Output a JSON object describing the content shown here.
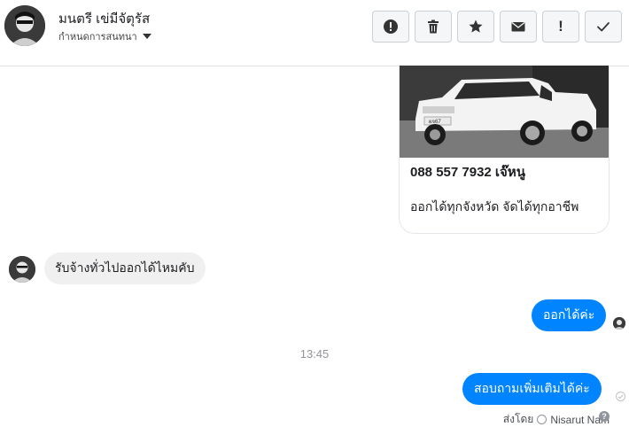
{
  "header": {
    "contact_name": "มนตรี เข่มีจัตุรัส",
    "contact_sub": "กำหนดการสนทนา",
    "toolbar": [
      {
        "name": "report-spam-button",
        "icon": "alert-circle-icon"
      },
      {
        "name": "delete-button",
        "icon": "trash-icon"
      },
      {
        "name": "star-button",
        "icon": "star-icon"
      },
      {
        "name": "mark-unread-button",
        "icon": "envelope-icon"
      },
      {
        "name": "flag-button",
        "icon": "exclamation-icon",
        "glyph": "!"
      },
      {
        "name": "mark-done-button",
        "icon": "checkmark-icon"
      }
    ]
  },
  "conversation": {
    "ad_card": {
      "line1": "088 557 7932 เจ๊หนู",
      "line2": "ออกได้ทุกจังหวัด จัดได้ทุกอาชีพ",
      "image_icon": "white-pickup-truck-photo",
      "plate": "ผจ67"
    },
    "incoming_message": "รับจ้างทั่วไปออกได้ไหมคับ",
    "outgoing_message_1": "ออกได้ค่ะ",
    "timestamp": "13:45",
    "outgoing_message_2": "สอบถามเพิ่มเติมได้ค่ะ",
    "sent_by_label": "ส่งโดย",
    "sent_by_name": "Nisarut Nam",
    "help_glyph": "?"
  },
  "colors": {
    "accent": "#0084ff",
    "incoming_bubble": "#f1f0f0",
    "border": "#dddfe2"
  }
}
